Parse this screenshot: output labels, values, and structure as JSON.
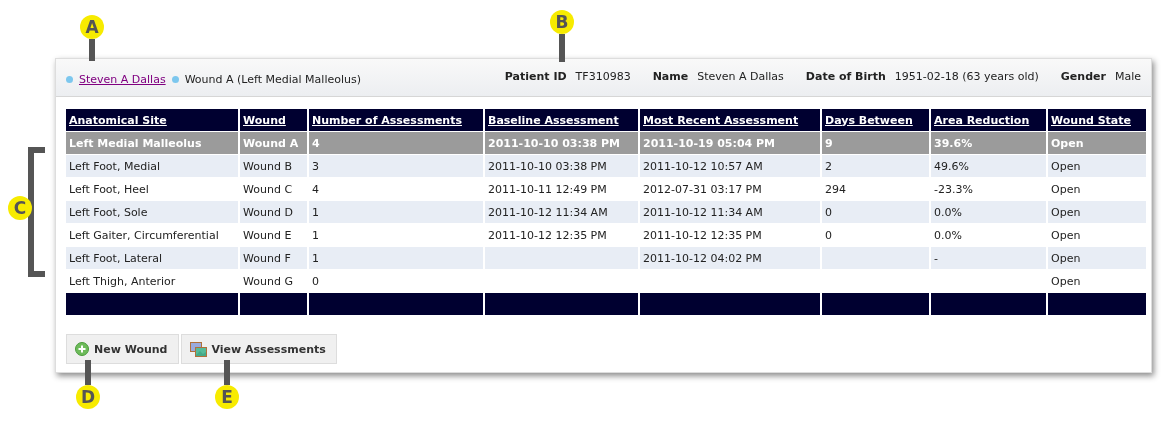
{
  "breadcrumb": {
    "patient_link": "Steven A Dallas",
    "current": "Wound A (Left Medial Malleolus)"
  },
  "patient_info": [
    {
      "label": "Patient ID",
      "value": "TF310983"
    },
    {
      "label": "Name",
      "value": "Steven A Dallas"
    },
    {
      "label": "Date of Birth",
      "value": "1951-02-18 (63 years old)"
    },
    {
      "label": "Gender",
      "value": "Male"
    }
  ],
  "table": {
    "columns": [
      "Anatomical Site",
      "Wound",
      "Number of Assessments",
      "Baseline Assessment",
      "Most Recent Assessment",
      "Days Between",
      "Area Reduction",
      "Wound State"
    ],
    "rows": [
      {
        "selected": true,
        "cells": [
          "Left Medial Malleolus",
          "Wound A",
          "4",
          "2011-10-10 03:38 PM",
          "2011-10-19 05:04 PM",
          "9",
          "39.6%",
          "Open"
        ]
      },
      {
        "selected": false,
        "cells": [
          "Left Foot, Medial",
          "Wound B",
          "3",
          "2011-10-10 03:38 PM",
          "2011-10-12 10:57 AM",
          "2",
          "49.6%",
          "Open"
        ]
      },
      {
        "selected": false,
        "cells": [
          "Left Foot, Heel",
          "Wound C",
          "4",
          "2011-10-11 12:49 PM",
          "2012-07-31 03:17 PM",
          "294",
          "-23.3%",
          "Open"
        ]
      },
      {
        "selected": false,
        "cells": [
          "Left Foot, Sole",
          "Wound D",
          "1",
          "2011-10-12 11:34 AM",
          "2011-10-12 11:34 AM",
          "0",
          "0.0%",
          "Open"
        ]
      },
      {
        "selected": false,
        "cells": [
          "Left Gaiter, Circumferential",
          "Wound E",
          "1",
          "2011-10-12 12:35 PM",
          "2011-10-12 12:35 PM",
          "0",
          "0.0%",
          "Open"
        ]
      },
      {
        "selected": false,
        "cells": [
          "Left Foot, Lateral",
          "Wound F",
          "1",
          "",
          "2011-10-12 04:02 PM",
          "",
          "-",
          "Open"
        ]
      },
      {
        "selected": false,
        "cells": [
          "Left Thigh, Anterior",
          "Wound G",
          "0",
          "",
          "",
          "",
          "",
          "Open"
        ]
      }
    ]
  },
  "buttons": [
    {
      "kind": "add",
      "label": "New Wound"
    },
    {
      "kind": "view",
      "label": "View Assessments"
    }
  ],
  "callouts": [
    {
      "label": "A",
      "kind": "down"
    },
    {
      "label": "B",
      "kind": "down"
    },
    {
      "label": "C",
      "kind": "bracket"
    },
    {
      "label": "D",
      "kind": "up"
    },
    {
      "label": "E",
      "kind": "up"
    }
  ]
}
